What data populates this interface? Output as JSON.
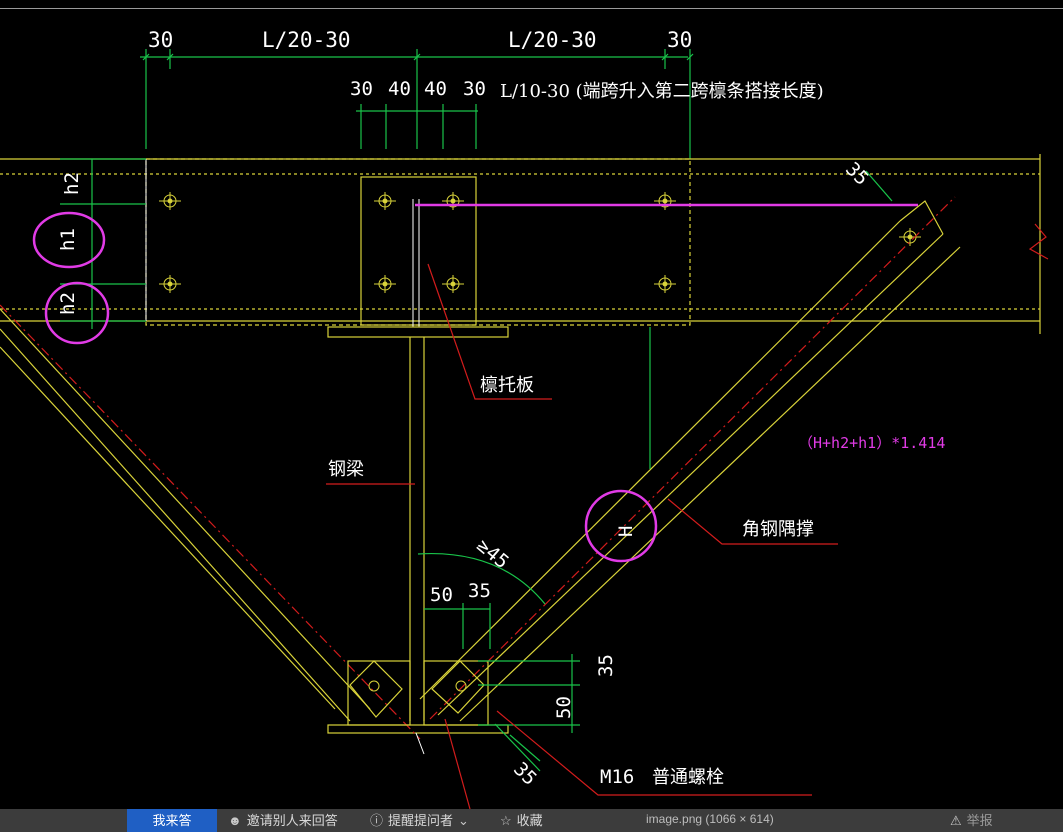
{
  "drawing": {
    "dims_top": [
      "30",
      "L/20-30",
      "L/20-30",
      "30"
    ],
    "dims_second": [
      "30",
      "40",
      "40",
      "30"
    ],
    "span_note": "L/10-30 (端跨升入第二跨檩条搭接长度)",
    "labels": {
      "h2_top": "h2",
      "h1": "h1",
      "h2_bottom": "h2",
      "purlin_plate": "檩托板",
      "steel_beam": "钢梁",
      "angle_brace": "角钢隅撑",
      "H": "H",
      "angle": "≥45",
      "dim_50": "50",
      "dim_35": "35",
      "dim_35_right": "35",
      "dim_50_right": "50",
      "dim_35_bottom": "35",
      "dim_35_top_right": "35",
      "bolt_size": "M16",
      "bolt_type": "普通螺栓"
    },
    "formula": "（H+h2+h1）*1.414"
  },
  "colors": {
    "yellow": "#d9d33a",
    "green": "#19c34a",
    "red": "#d21c1c",
    "magenta": "#e13be6"
  },
  "bottom_bar": {
    "answer_button": "我来答",
    "invite": "邀请别人来回答",
    "remind": "提醒提问者",
    "favorite": "收藏",
    "filename": "image.png (1066 × 614)",
    "report": "举报"
  }
}
